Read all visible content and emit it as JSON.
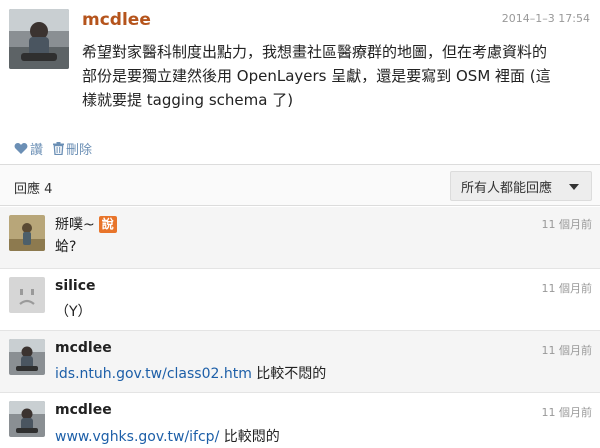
{
  "post": {
    "author": "mcdlee",
    "timestamp": "2014–1–3 17:54",
    "body_line1": "希望對家醫科制度出點力，我想畫社區醫療群的地圖，但在考慮資料的",
    "body_line2": "部份是要獨立建然後用 OpenLayers 呈獻，還是要寫到 OSM 裡面 (這",
    "body_line3": "樣就要提 tagging schema 了)",
    "like_label": "讚",
    "delete_label": "刪除"
  },
  "reply_bar": {
    "count_label": "回應 4",
    "audience_label": "所有人都能回應"
  },
  "replies": [
    {
      "author": "掰噗~",
      "badge": "說",
      "time": "11 個月前",
      "text": "蛤?"
    },
    {
      "author": "silice",
      "time": "11 個月前",
      "text": "（Y）"
    },
    {
      "author": "mcdlee",
      "time": "11 個月前",
      "link": "ids.ntuh.gov.tw/class02.htm",
      "text_after": " 比較不悶的"
    },
    {
      "author": "mcdlee",
      "time": "11 個月前",
      "link": "www.vghks.gov.tw/ifcp/",
      "text_after": " 比較悶的"
    }
  ],
  "colors": {
    "author_orange": "#b5541c",
    "link_blue": "#1d5fa8",
    "action_blue": "#6b8fb5",
    "badge_orange": "#e8742a"
  }
}
